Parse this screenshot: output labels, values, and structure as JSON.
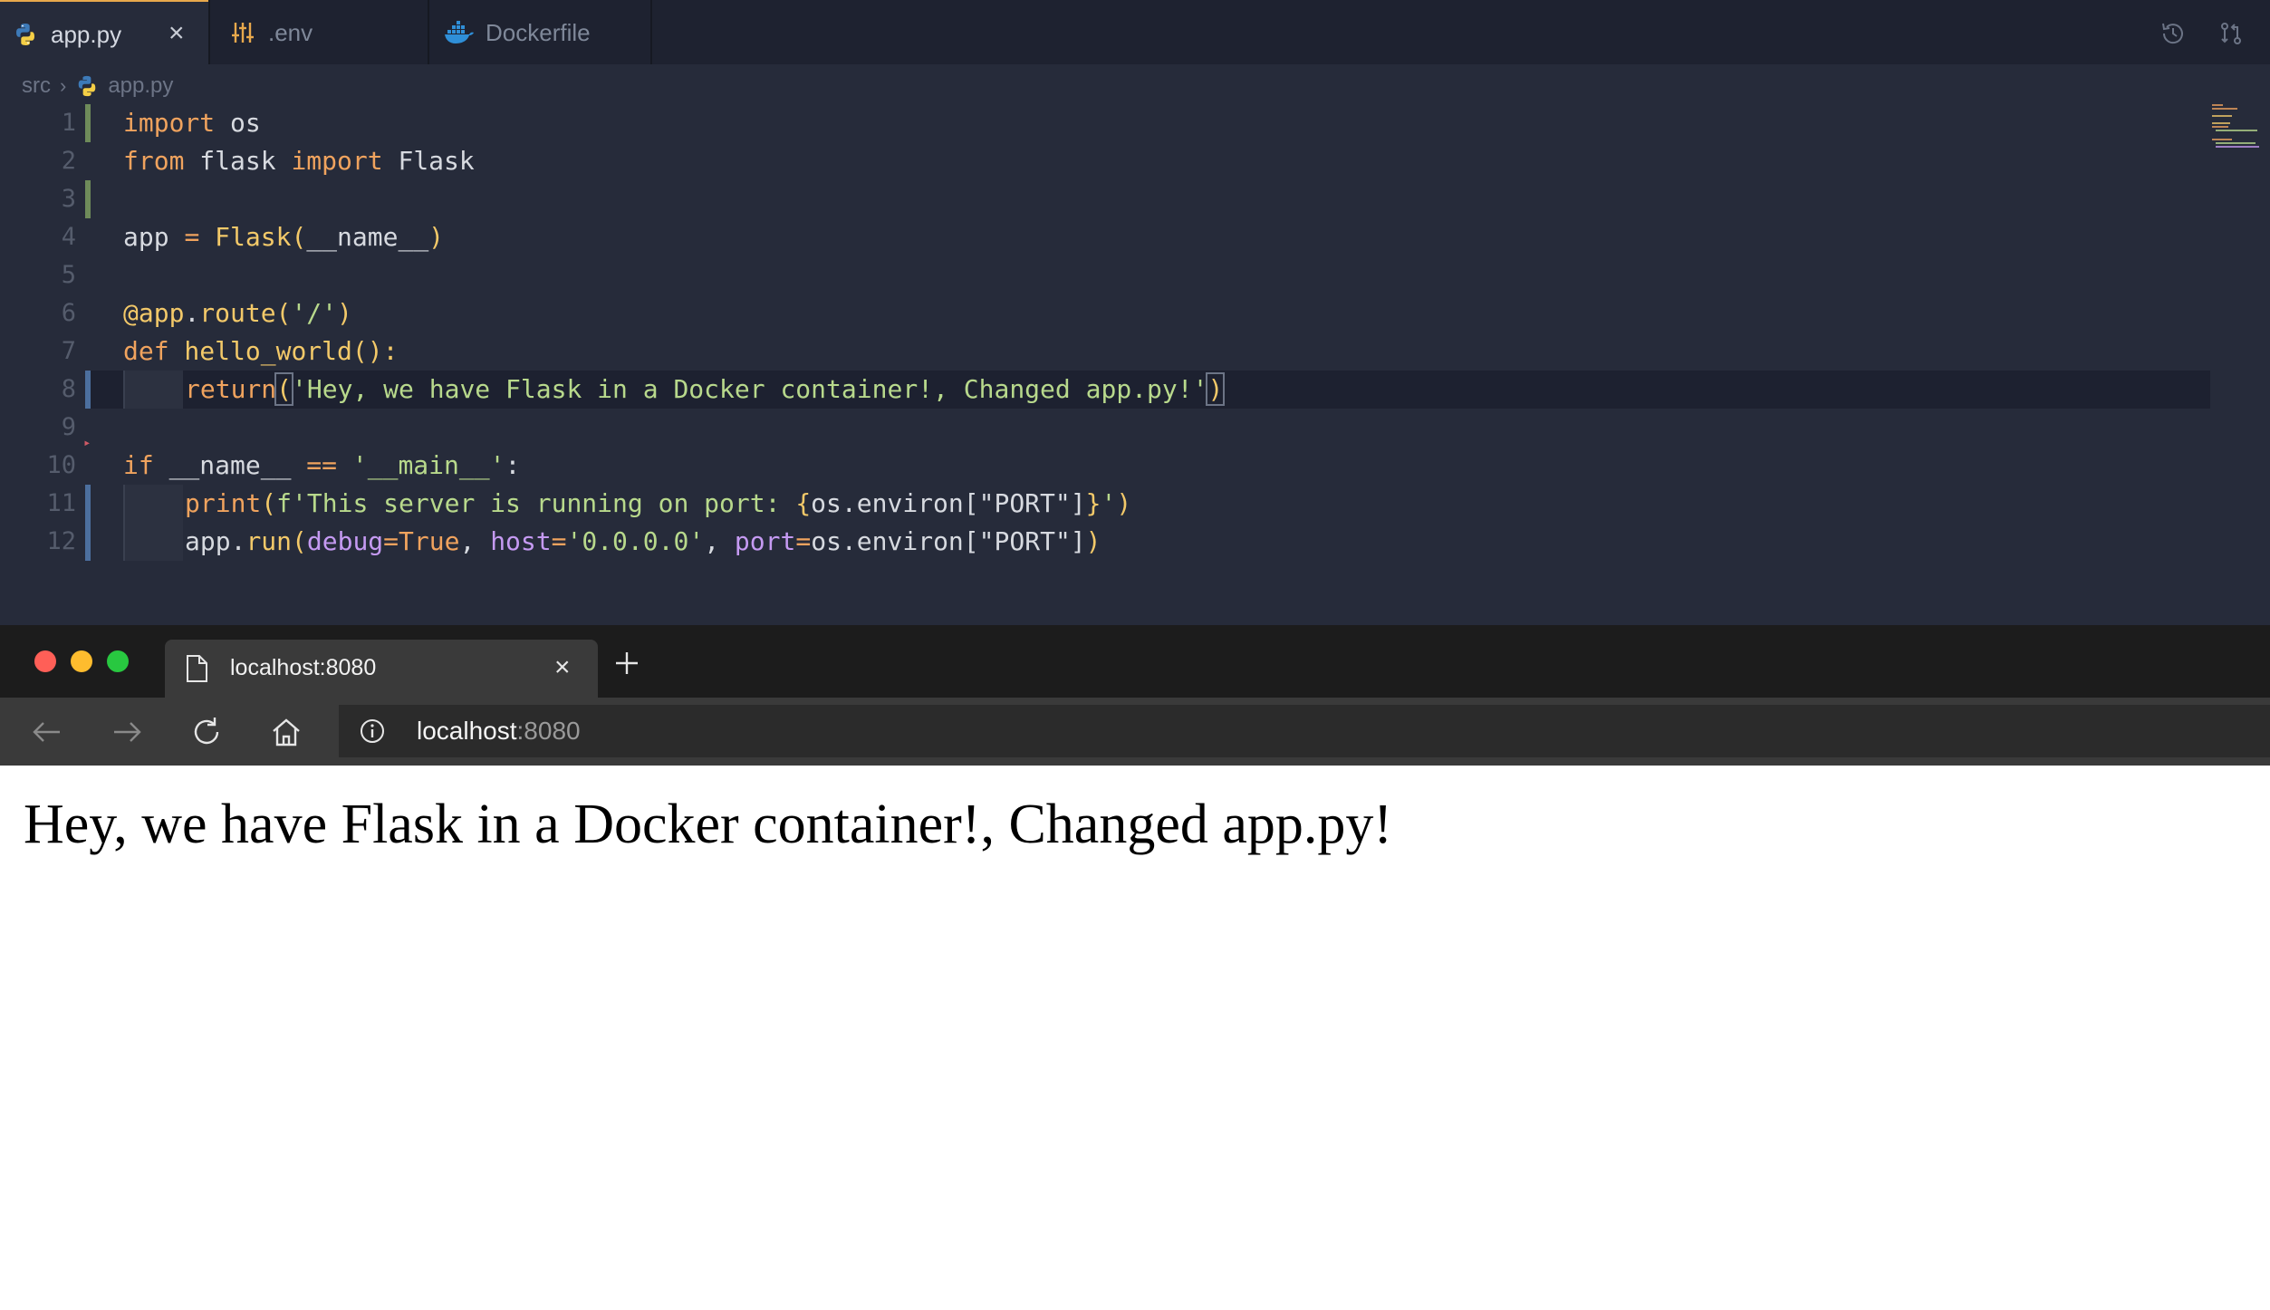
{
  "editor": {
    "tabs": [
      {
        "label": "app.py",
        "icon": "python-icon",
        "active": true
      },
      {
        "label": ".env",
        "icon": "sliders-icon",
        "active": false
      },
      {
        "label": "Dockerfile",
        "icon": "docker-icon",
        "active": false
      }
    ],
    "breadcrumb": {
      "folder": "src",
      "file": "app.py"
    },
    "line_numbers": [
      "1",
      "2",
      "3",
      "4",
      "5",
      "6",
      "7",
      "8",
      "9",
      "10",
      "11",
      "12"
    ],
    "tokens": {
      "l1_import": "import",
      "l1_os": " os",
      "l2_from": "from",
      "l2_flask": " flask ",
      "l2_import": "import",
      "l2_Flask": " Flask",
      "l4_app": "app ",
      "l4_eq": "=",
      "l4_Flask": " Flask",
      "l4_open": "(",
      "l4_name": "__name__",
      "l4_close": ")",
      "l6_dec": "@app",
      "l6_dot": ".",
      "l6_route": "route",
      "l6_open": "(",
      "l6_str": "'/'",
      "l6_close": ")",
      "l7_def": "def",
      "l7_fn": " hello_world",
      "l7_parens": "():",
      "l8_return": "return",
      "l8_open": "(",
      "l8_str": "'Hey, we have Flask in a Docker container!, Changed app.py!'",
      "l8_close": ")",
      "l10_if": "if",
      "l10_name": " __name__ ",
      "l10_eqeq": "==",
      "l10_str": " '__main__'",
      "l10_colon": ":",
      "l11_print": "print",
      "l11_open": "(",
      "l11_f": "f'This server is running on port: ",
      "l11_lb": "{",
      "l11_os": "os.environ",
      "l11_key": "[\"PORT\"]",
      "l11_rb": "}",
      "l11_q": "'",
      "l11_close": ")",
      "l12_app": "app",
      "l12_dot": ".",
      "l12_run": "run",
      "l12_open": "(",
      "l12_debug": "debug",
      "l12_eq1": "=",
      "l12_true": "True",
      "l12_comma1": ", ",
      "l12_host": "host",
      "l12_eq2": "=",
      "l12_hoststr": "'0.0.0.0'",
      "l12_comma2": ", ",
      "l12_port": "port",
      "l12_eq3": "=",
      "l12_osenv": "os.environ",
      "l12_key": "[\"PORT\"]",
      "l12_close": ")"
    },
    "top_right_icons": [
      "history-icon",
      "compare-icon"
    ]
  },
  "browser": {
    "tab_title": "localhost:8080",
    "url_host": "localhost",
    "url_port": ":8080",
    "page_heading": "Hey, we have Flask in a Docker container!, Changed app.py!"
  },
  "colors": {
    "editor_bg": "#262b3a",
    "keyword": "#f0a35e",
    "function": "#f3c969",
    "string": "#b8d98c",
    "param": "#c59af2",
    "active_tab_accent": "#e8a94c",
    "traffic_red": "#ff5f57",
    "traffic_yellow": "#febc2e",
    "traffic_green": "#28c840"
  }
}
